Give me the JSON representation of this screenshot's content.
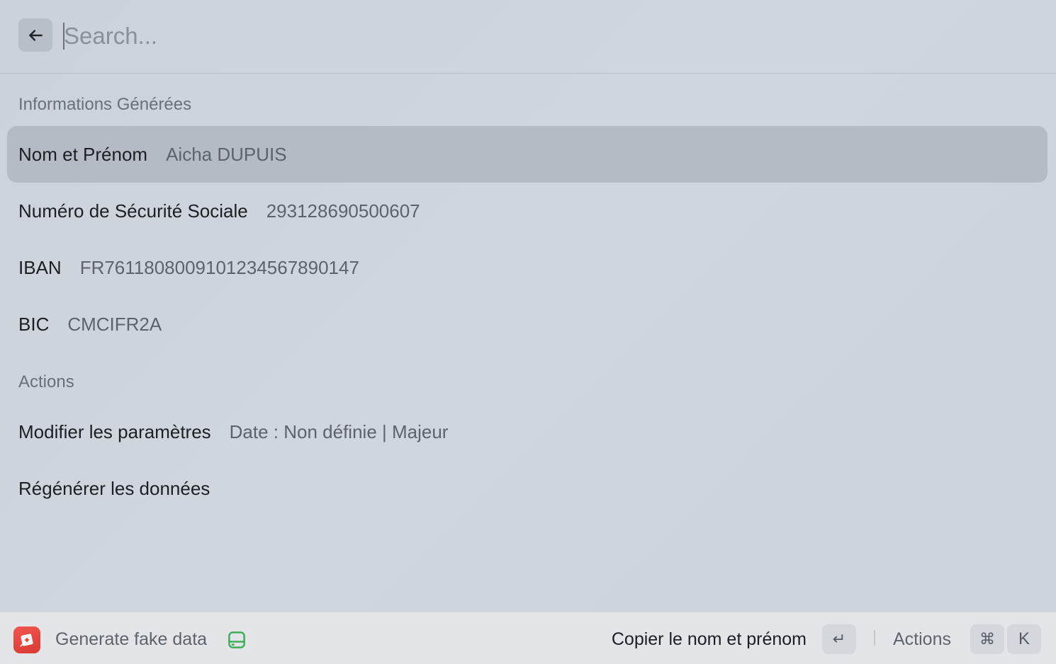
{
  "search": {
    "placeholder": "Search...",
    "value": ""
  },
  "sections": [
    {
      "title": "Informations Générées",
      "items": [
        {
          "title": "Nom et Prénom",
          "subtitle": "Aicha DUPUIS",
          "selected": true
        },
        {
          "title": "Numéro de Sécurité Sociale",
          "subtitle": "293128690500607"
        },
        {
          "title": "IBAN",
          "subtitle": "FR7611808009101234567890147"
        },
        {
          "title": "BIC",
          "subtitle": "CMCIFR2A"
        }
      ]
    },
    {
      "title": "Actions",
      "items": [
        {
          "title": "Modifier les paramètres",
          "subtitle": "Date : Non définie | Majeur"
        },
        {
          "title": "Régénérer les données",
          "subtitle": ""
        }
      ]
    }
  ],
  "footer": {
    "app_name": "Generate fake data",
    "app_icon": "generate-data-icon",
    "storage_icon": "storage-icon",
    "primary_action": "Copier le nom et prénom",
    "enter_key": "↵",
    "actions_label": "Actions",
    "cmd_key": "⌘",
    "k_key": "K"
  },
  "colors": {
    "selected_row": "#b5bbc4",
    "app_icon_red": "#e44a43",
    "storage_icon_green": "#3fae5a"
  }
}
